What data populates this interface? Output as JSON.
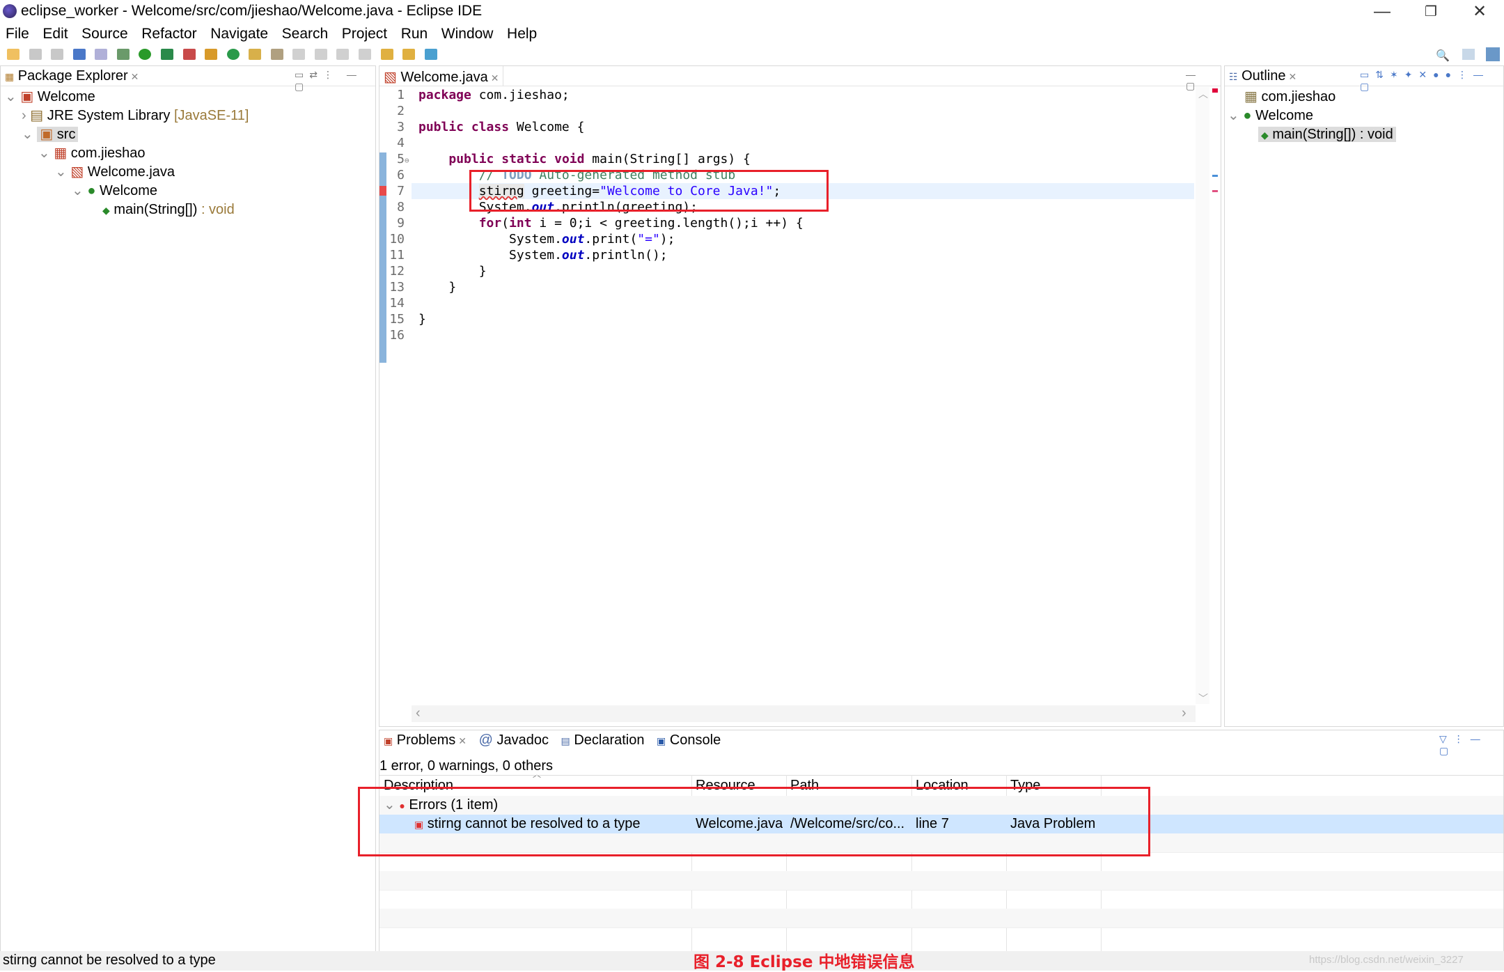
{
  "window": {
    "title": "eclipse_worker - Welcome/src/com/jieshao/Welcome.java - Eclipse IDE",
    "minimize": "—",
    "restore": "❐",
    "close": "✕"
  },
  "menu": [
    "File",
    "Edit",
    "Source",
    "Refactor",
    "Navigate",
    "Search",
    "Project",
    "Run",
    "Window",
    "Help"
  ],
  "package_explorer": {
    "tab": "Package Explorer",
    "tree": [
      {
        "label": "Welcome",
        "suffix": ""
      },
      {
        "label": "JRE System Library",
        "suffix": "[JavaSE-11]"
      },
      {
        "label": "src",
        "suffix": ""
      },
      {
        "label": "com.jieshao",
        "suffix": ""
      },
      {
        "label": "Welcome.java",
        "suffix": ""
      },
      {
        "label": "Welcome",
        "suffix": ""
      },
      {
        "label": "main(String[])",
        "suffix": ": void"
      }
    ]
  },
  "editor": {
    "tab": "Welcome.java",
    "lines": [
      {
        "n": "1",
        "text": "package com.jieshao;"
      },
      {
        "n": "2",
        "text": ""
      },
      {
        "n": "3",
        "text": "public class Welcome {"
      },
      {
        "n": "4",
        "text": ""
      },
      {
        "n": "5",
        "text": "    public static void main(String[] args) {"
      },
      {
        "n": "6",
        "text": "        // TODO Auto-generated method stub"
      },
      {
        "n": "7",
        "text": "        stirng greeting=\"Welcome to Core Java!\";"
      },
      {
        "n": "8",
        "text": "        System.out.println(greeting);"
      },
      {
        "n": "9",
        "text": "        for(int i = 0;i < greeting.length();i ++) {"
      },
      {
        "n": "10",
        "text": "            System.out.print(\"=\");"
      },
      {
        "n": "11",
        "text": "            System.out.println();"
      },
      {
        "n": "12",
        "text": "        }"
      },
      {
        "n": "13",
        "text": "    }"
      },
      {
        "n": "14",
        "text": ""
      },
      {
        "n": "15",
        "text": "}"
      },
      {
        "n": "16",
        "text": ""
      }
    ]
  },
  "outline": {
    "tab": "Outline",
    "tree": [
      {
        "label": "com.jieshao"
      },
      {
        "label": "Welcome"
      },
      {
        "label": "main(String[]) : void"
      }
    ]
  },
  "bottom_tabs": [
    "Problems",
    "Javadoc",
    "Declaration",
    "Console"
  ],
  "problems": {
    "summary": "1 error, 0 warnings, 0 others",
    "columns": [
      "Description",
      "Resource",
      "Path",
      "Location",
      "Type"
    ],
    "group": "Errors (1 item)",
    "rows": [
      {
        "description": "stirng cannot be resolved to a type",
        "resource": "Welcome.java",
        "path": "/Welcome/src/co...",
        "location": "line 7",
        "type": "Java Problem"
      }
    ]
  },
  "status_bar": {
    "message": "stirng cannot be resolved to a type",
    "caption": "图 2-8 Eclipse 中地错误信息",
    "watermark": "https://blog.csdn.net/weixin_3227"
  },
  "colors": {
    "highlight_red": "#e8202a",
    "selection_blue": "#cfe6ff",
    "keyword": "#7f0055",
    "string": "#2a00ff",
    "comment": "#3f7f5f"
  }
}
